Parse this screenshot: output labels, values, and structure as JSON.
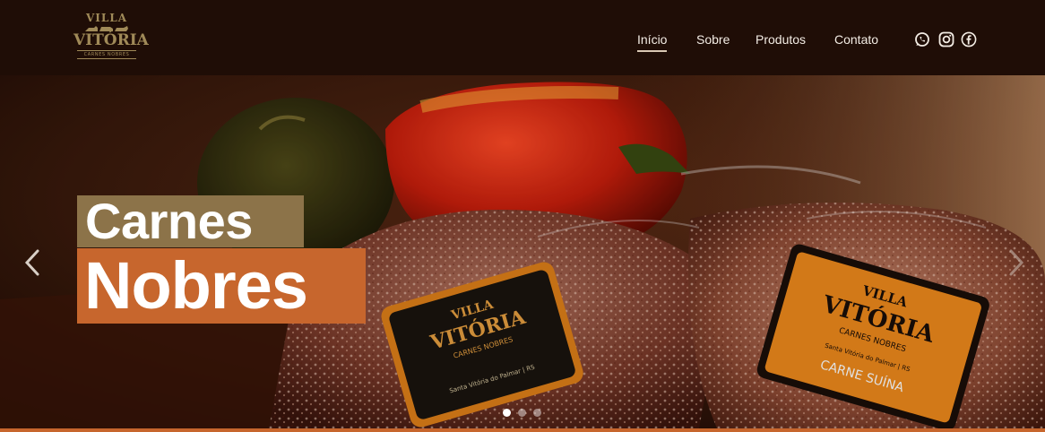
{
  "brand": {
    "line1": "VILLA",
    "line2": "VITÓRIA",
    "line3": "CARNES NOBRES",
    "colors": {
      "header_bg": "#1f0d06",
      "gold": "#a08a58",
      "orange": "#c7662d"
    }
  },
  "nav": {
    "items": [
      {
        "label": "Início",
        "active": true
      },
      {
        "label": "Sobre",
        "active": false
      },
      {
        "label": "Produtos",
        "active": false
      },
      {
        "label": "Contato",
        "active": false
      }
    ]
  },
  "social": [
    "whatsapp-icon",
    "instagram-icon",
    "facebook-icon"
  ],
  "hero": {
    "headline_line1": "Carnes",
    "headline_line2": "Nobres",
    "label_left": {
      "brand1": "VILLA",
      "brand2": "VITÓRIA",
      "sub": "CARNES NOBRES",
      "place": "Santa Vitória do Palmar | RS"
    },
    "label_right": {
      "brand1": "VILLA",
      "brand2": "VITÓRIA",
      "sub": "CARNES NOBRES",
      "place": "Santa Vitória do Palmar | RS",
      "product": "CARNE SUÍNA"
    }
  },
  "carousel": {
    "slides": 3,
    "active_slide": 1,
    "prev_icon": "chevron-left-icon",
    "next_icon": "chevron-right-icon"
  }
}
